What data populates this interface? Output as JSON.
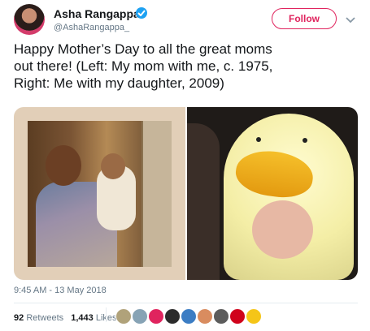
{
  "author": {
    "name": "Asha Rangappa",
    "handle": "@AshaRangappa_",
    "verified": true,
    "avatar": "avatar"
  },
  "follow_button": {
    "label": "Follow",
    "color": "#e0245e"
  },
  "menu": {
    "icon": "chevron-down-icon"
  },
  "tweet": {
    "text": "Happy Mother’s Day to all the great moms\nout there! (Left: My mom with me, c. 1975,\nRight: Me with my daughter, 2009)"
  },
  "media": {
    "images": [
      "photo-left",
      "photo-right"
    ]
  },
  "timestamp": "9:45 AM - 13 May 2018",
  "stats": {
    "retweets_count": "92",
    "retweets_label": "Retweets",
    "likes_count": "1,443",
    "likes_label": "Likes"
  },
  "liker_colors": [
    "#b0a27a",
    "#87a3b5",
    "#e0245e",
    "#2b2b2b",
    "#3b7dc4",
    "#d98c5f",
    "#5c5c5c",
    "#d0021b",
    "#f5c518"
  ],
  "colors": {
    "accent": "#1da1f2",
    "secondary_text": "#657786"
  }
}
